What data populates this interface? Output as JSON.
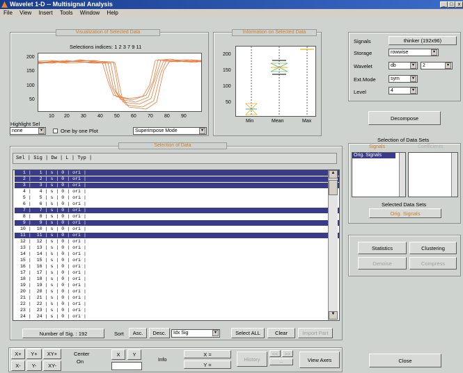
{
  "window": {
    "title": "Wavelet 1-D -- Multisignal Analysis",
    "min": "_",
    "max": "□",
    "close": "x"
  },
  "menu": [
    "File",
    "View",
    "Insert",
    "Tools",
    "Window",
    "Help"
  ],
  "visualization": {
    "title": "Visualization of Selected Data",
    "selections": "Selections indices: 1  2  3  7  9 11",
    "yticks": [
      "200",
      "150",
      "100",
      "50"
    ],
    "xticks": [
      "10",
      "20",
      "30",
      "40",
      "50",
      "60",
      "70",
      "80",
      "90"
    ],
    "highlight_label": "Highlight Sel",
    "highlight_value": "none",
    "one_by_one": "One by one Plot",
    "mode": "Superimpose Mode",
    "color": "#e87a3a"
  },
  "information": {
    "title": "Information on Selected Data",
    "yticks": [
      "200",
      "150",
      "100",
      "50"
    ],
    "xticks": [
      "Min",
      "Mean",
      "Max"
    ]
  },
  "settings": {
    "signals_label": "Signals",
    "signals_value": "thinker (192x96)",
    "storage_label": "Storage",
    "storage_value": "rowwise",
    "wavelet_label": "Wavelet",
    "wavelet_family": "db",
    "wavelet_num": "2",
    "extmode_label": "Ext.Mode",
    "extmode_value": "sym",
    "level_label": "Level",
    "level_value": "4"
  },
  "decompose": "Decompose",
  "data_sets": {
    "title": "Selection of Data Sets",
    "signals_tab": "Signals",
    "coeffs_tab": "Coefficients",
    "list_item": "Orig. Signals",
    "selected_label": "Selected Data Sets",
    "selected_value": "Orig. Signals"
  },
  "actions": {
    "statistics": "Statistics",
    "clustering": "Clustering",
    "denoise": "Denoise",
    "compress": "Compress"
  },
  "selection": {
    "title": "Selection of Data",
    "header": "Sel | Sig | Dw | L | Typ |",
    "rows": [
      "  1 |   1 | s | 0 | ori |",
      "  2 |   2 | s | 0 | ori |",
      "  3 |   3 | s | 0 | ori |",
      "  4 |   4 | s | 0 | ori |",
      "  5 |   5 | s | 0 | ori |",
      "  6 |   6 | s | 0 | ori |",
      "  7 |   7 | s | 0 | ori |",
      "  8 |   8 | s | 0 | ori |",
      "  9 |   9 | s | 0 | ori |",
      " 10 |  10 | s | 0 | ori |",
      " 11 |  11 | s | 0 | ori |",
      " 12 |  12 | s | 0 | ori |",
      " 13 |  13 | s | 0 | ori |",
      " 14 |  14 | s | 0 | ori |",
      " 15 |  15 | s | 0 | ori |",
      " 16 |  16 | s | 0 | ori |",
      " 17 |  17 | s | 0 | ori |",
      " 18 |  18 | s | 0 | ori |",
      " 19 |  19 | s | 0 | ori |",
      " 20 |  20 | s | 0 | ori |",
      " 21 |  21 | s | 0 | ori |",
      " 22 |  22 | s | 0 | ori |",
      " 23 |  23 | s | 0 | ori |",
      " 24 |  24 | s | 0 | ori |"
    ],
    "selected_rows": [
      1,
      2,
      3,
      7,
      9,
      11
    ],
    "number_label": "Number of Sig. : 192",
    "sort": "Sort",
    "asc": "Asc.",
    "desc": "Desc.",
    "sort_key": "Idx Sig",
    "select_all": "Select ALL",
    "clear": "Clear",
    "import": "Import Part"
  },
  "bottom": {
    "xp": "X+",
    "yp": "Y+",
    "xyp": "XY+",
    "xm": "X-",
    "ym": "Y-",
    "xym": "XY-",
    "center": "Center",
    "on": "On",
    "x": "X",
    "y": "Y",
    "info": "Info",
    "xeq": "X =",
    "yeq": "Y =",
    "history": "History",
    "view_axes": "View Axes",
    "close": "Close"
  }
}
